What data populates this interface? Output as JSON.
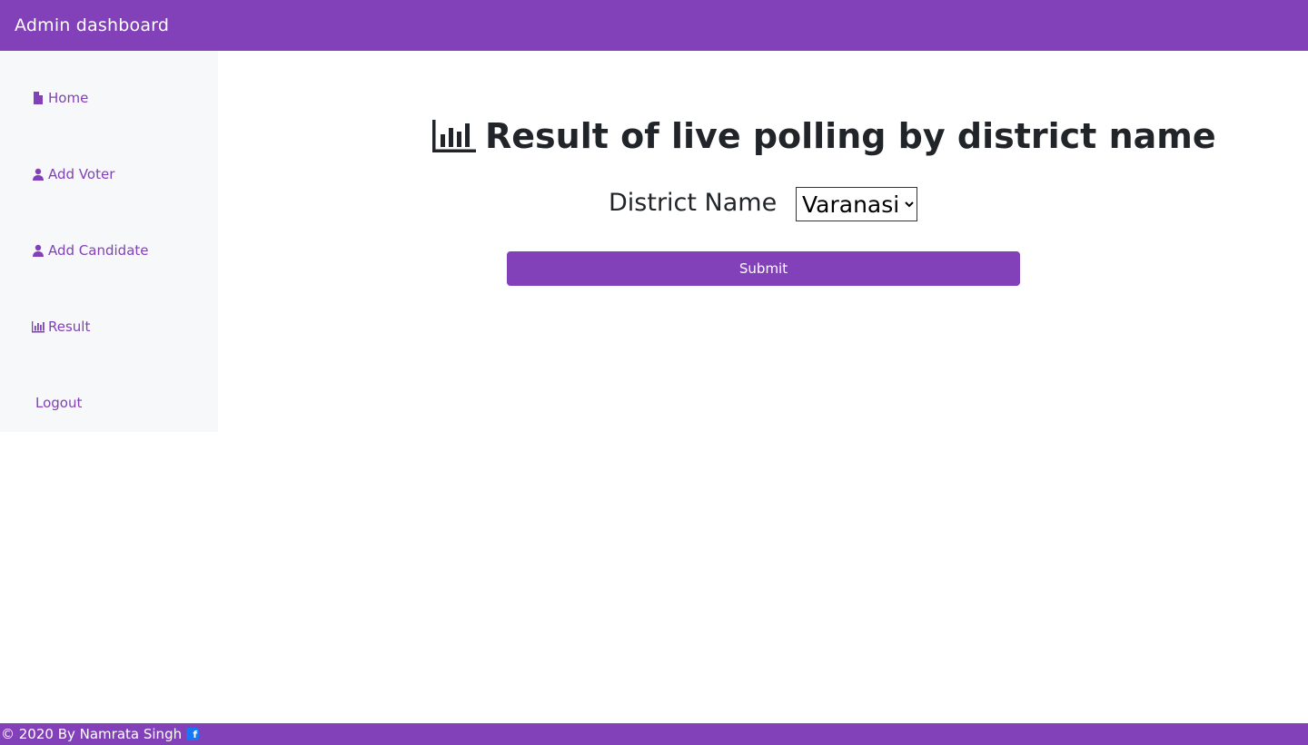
{
  "header": {
    "title": "Admin dashboard"
  },
  "sidebar": {
    "items": [
      {
        "label": "Home",
        "icon": "file-icon"
      },
      {
        "label": "Add Voter",
        "icon": "user-icon"
      },
      {
        "label": "Add Candidate",
        "icon": "user-icon"
      },
      {
        "label": "Result",
        "icon": "bar-chart-icon"
      },
      {
        "label": "Logout",
        "icon": ""
      }
    ]
  },
  "main": {
    "title": "Result of live polling by district name",
    "title_icon": "bar-chart-icon",
    "district_label": "District Name",
    "district_selected": "Varanasi",
    "submit_label": "Submit"
  },
  "footer": {
    "text": "© 2020 By Namrata Singh",
    "icon": "facebook-icon"
  },
  "colors": {
    "accent": "#8241b8",
    "sidebar_bg": "#f7f8fa",
    "facebook": "#1877f2"
  }
}
